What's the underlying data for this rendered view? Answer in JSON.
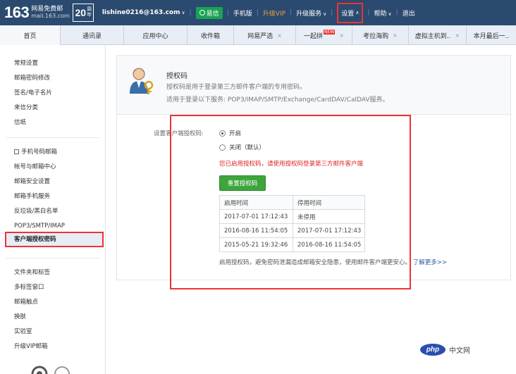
{
  "topbar": {
    "logo_number": "163",
    "logo_line1": "网易免费邮",
    "logo_line2": "mail.163.com",
    "logo_anniv": "20",
    "logo_anniv_unit": "周年",
    "email": "lishine0216@163.com",
    "yixin": "易信",
    "mobile": "手机版",
    "upgrade_vip": "升级VIP",
    "upgrade_service": "升级服务",
    "settings": "设置",
    "help": "帮助",
    "logout": "退出",
    "background_color": "#2b4a6f"
  },
  "tabs": [
    {
      "label": "首页",
      "closable": false
    },
    {
      "label": "通讯录",
      "closable": false
    },
    {
      "label": "应用中心",
      "closable": false
    },
    {
      "label": "收件箱",
      "closable": false
    },
    {
      "label": "网易严选",
      "closable": true
    },
    {
      "label": "一起拼",
      "closable": true,
      "badge": "NEW"
    },
    {
      "label": "考拉海购",
      "closable": true
    },
    {
      "label": "虚拟主机到..",
      "closable": true
    },
    {
      "label": "本月最后一..",
      "closable": false
    }
  ],
  "sidebar": {
    "group1": [
      "常规设置",
      "邮箱密码修改",
      "签名/电子名片",
      "来信分类",
      "信纸"
    ],
    "group2": [
      "手机号码邮箱",
      "帐号与邮箱中心",
      "邮箱安全设置",
      "邮箱手机服务",
      "反垃圾/黑白名单",
      "POP3/SMTP/IMAP"
    ],
    "active": "客户端授权密码",
    "group3": [
      "文件夹和标签",
      "多标签窗口",
      "邮箱触点",
      "换肤",
      "实验室",
      "升级VIP邮箱"
    ]
  },
  "main": {
    "title": "授权码",
    "desc1": "授权码是用于登录第三方邮件客户端的专用密码。",
    "desc2": "适用于登录以下服务: POP3/IMAP/SMTP/Exchange/CardDAV/CalDAV服务。",
    "setting_label": "设置客户端授权码:",
    "radio_on": "开启",
    "radio_off": "关闭（默认）",
    "warning": "您已启用授权码，请使用授权码登录第三方邮件客户端",
    "reset_button": "重置授权码",
    "table_headers": [
      "启用时间",
      "停用时间"
    ],
    "table_rows": [
      [
        "2017-07-01 17:12:43",
        "未停用"
      ],
      [
        "2016-08-16 11:54:05",
        "2017-07-01 17:12:43"
      ],
      [
        "2015-05-21 19:32:46",
        "2016-08-16 11:54:05"
      ]
    ],
    "footer": "启用授权码，避免密码泄漏造成邮箱安全隐患，使用邮件客户端更安心。",
    "learn_more": "了解更多>>"
  },
  "watermark": {
    "logo": "php",
    "text": "中文网"
  },
  "colors": {
    "highlight_red": "#e33",
    "button_green": "#3ea53c",
    "warning_red": "#d22"
  }
}
